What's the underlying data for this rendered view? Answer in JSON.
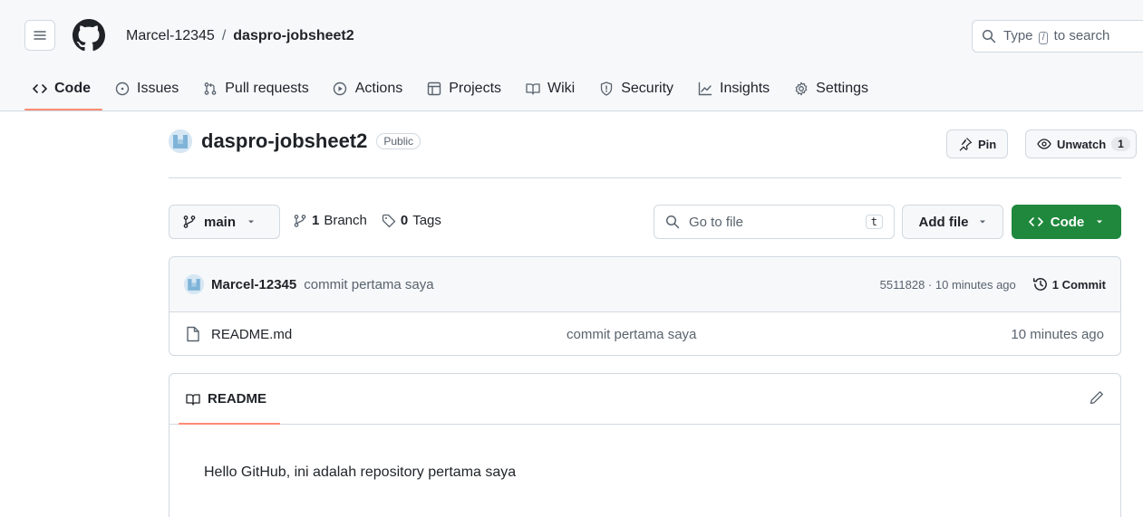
{
  "header": {
    "owner": "Marcel-12345",
    "separator": "/",
    "repo": "daspro-jobsheet2",
    "search_before": "Type",
    "search_key": "/",
    "search_after": "to search"
  },
  "tabs": [
    {
      "label": "Code",
      "icon": "code-icon",
      "active": true
    },
    {
      "label": "Issues",
      "icon": "issue-icon"
    },
    {
      "label": "Pull requests",
      "icon": "pull-request-icon"
    },
    {
      "label": "Actions",
      "icon": "play-icon"
    },
    {
      "label": "Projects",
      "icon": "table-icon"
    },
    {
      "label": "Wiki",
      "icon": "book-icon"
    },
    {
      "label": "Security",
      "icon": "shield-icon"
    },
    {
      "label": "Insights",
      "icon": "graph-icon"
    },
    {
      "label": "Settings",
      "icon": "gear-icon"
    }
  ],
  "repo": {
    "name": "daspro-jobsheet2",
    "visibility": "Public",
    "pin_label": "Pin",
    "unwatch_label": "Unwatch",
    "watch_count": "1"
  },
  "branch": {
    "current": "main",
    "branch_count": "1",
    "branch_label": "Branch",
    "tag_count": "0",
    "tag_label": "Tags",
    "goto_placeholder": "Go to file",
    "goto_key": "t",
    "add_file_label": "Add file",
    "code_label": "Code"
  },
  "commit": {
    "author": "Marcel-12345",
    "message": "commit pertama saya",
    "meta": "5511828 · 10 minutes ago",
    "count_label": "1 Commit"
  },
  "files": [
    {
      "name": "README.md",
      "message": "commit pertama saya",
      "time": "10 minutes ago"
    }
  ],
  "readme": {
    "tab_label": "README",
    "content": "Hello GitHub, ini adalah repository pertama saya"
  },
  "colors": {
    "accent_underline": "#fd8c73",
    "primary_button": "#1f883d",
    "header_bg": "#f6f8fa"
  }
}
